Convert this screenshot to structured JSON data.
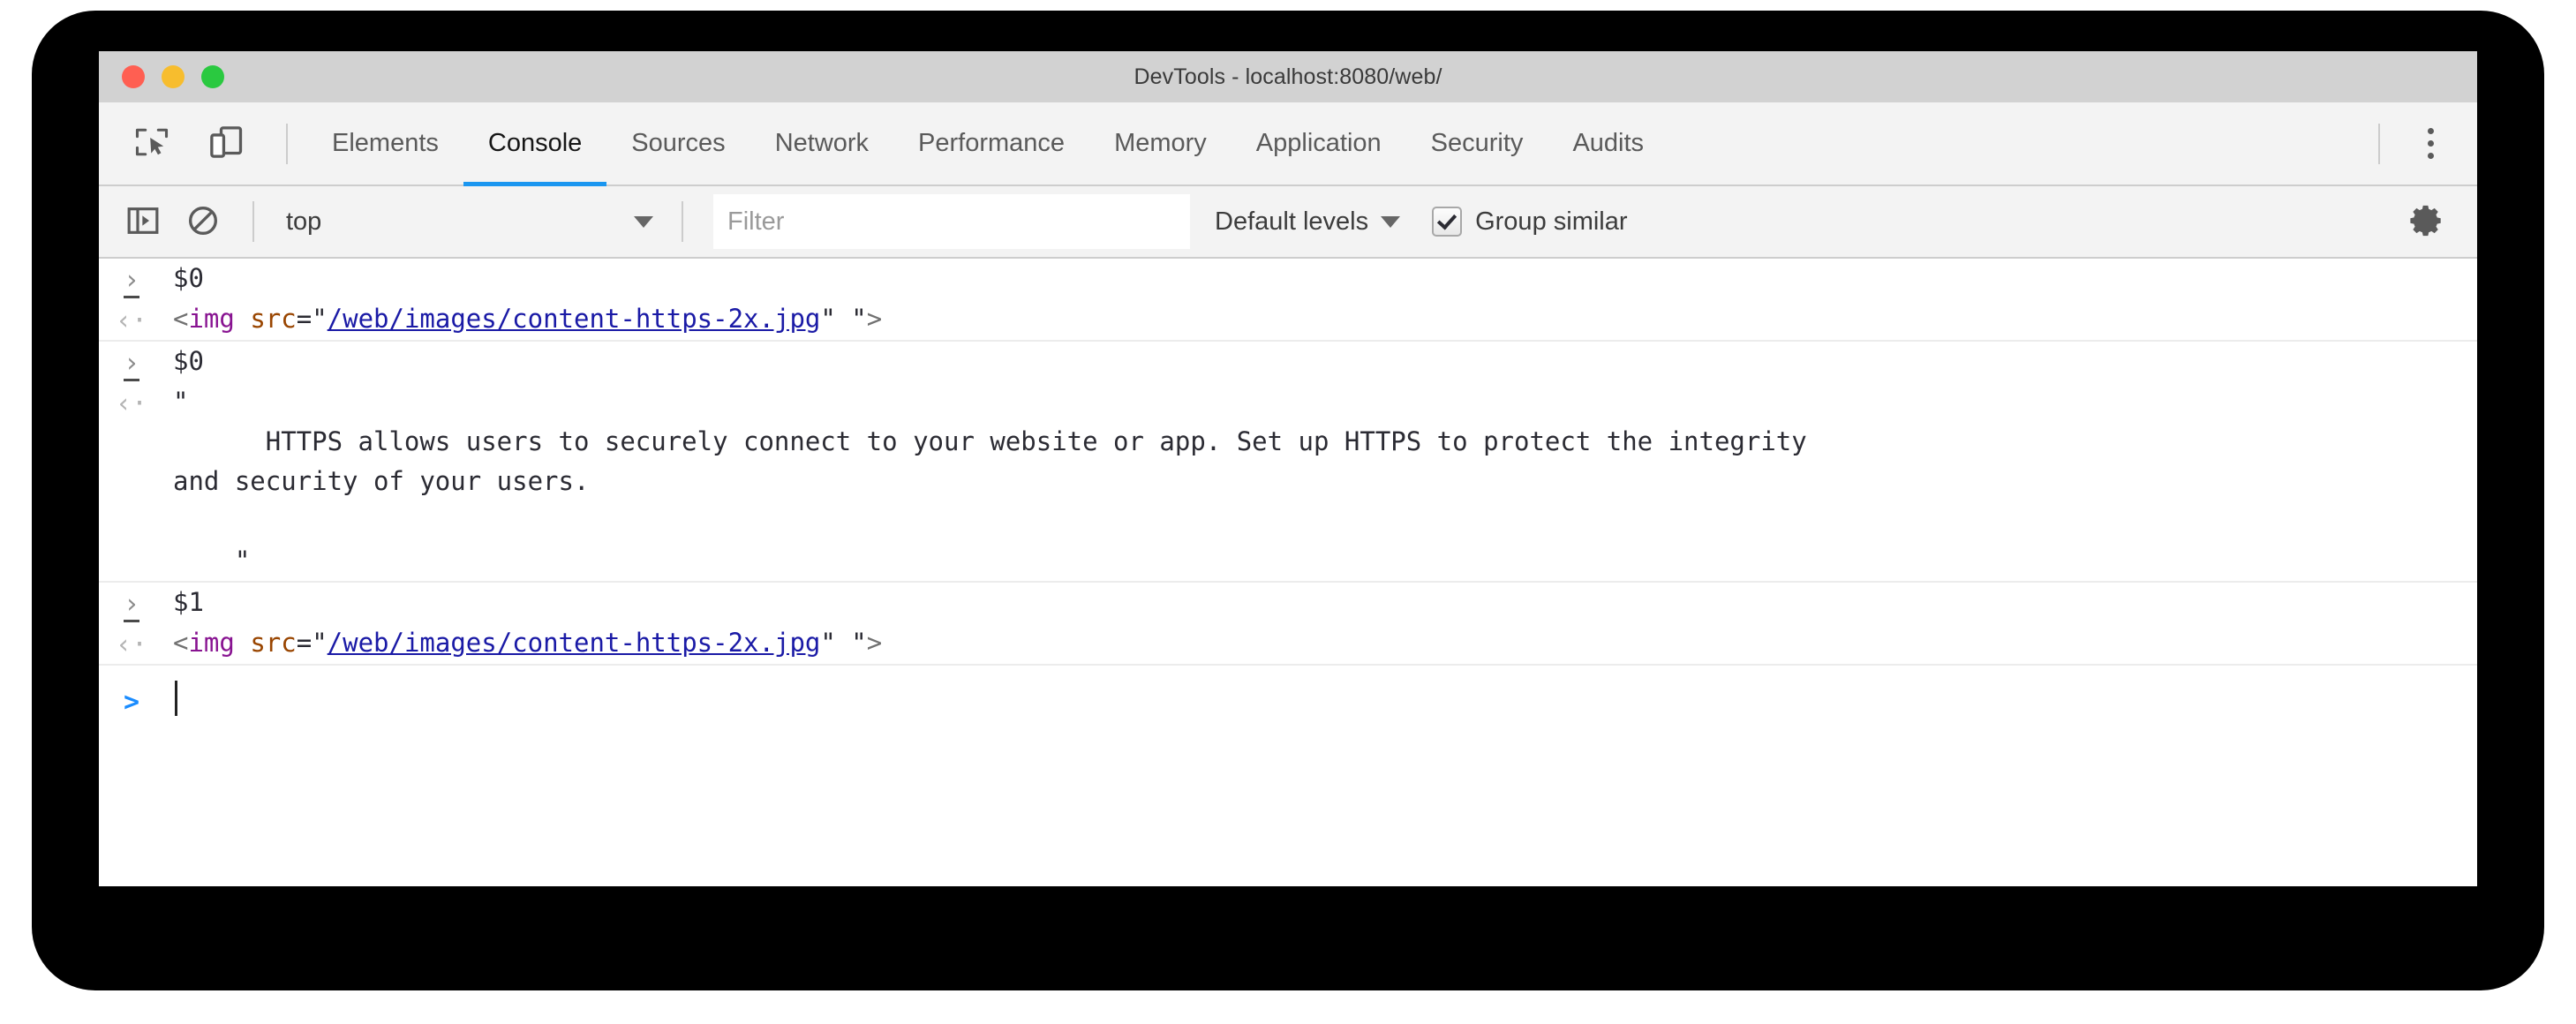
{
  "window": {
    "title": "DevTools - localhost:8080/web/",
    "traffic_lights": [
      {
        "name": "close",
        "color": "#ff5f52"
      },
      {
        "name": "minimize",
        "color": "#f7bd2e"
      },
      {
        "name": "maximize",
        "color": "#2ac940"
      }
    ]
  },
  "toolbar_icons": {
    "inspect": "inspect-element-icon",
    "device": "device-toolbar-icon"
  },
  "tabs": [
    {
      "label": "Elements",
      "active": false
    },
    {
      "label": "Console",
      "active": true
    },
    {
      "label": "Sources",
      "active": false
    },
    {
      "label": "Network",
      "active": false
    },
    {
      "label": "Performance",
      "active": false
    },
    {
      "label": "Memory",
      "active": false
    },
    {
      "label": "Application",
      "active": false
    },
    {
      "label": "Security",
      "active": false
    },
    {
      "label": "Audits",
      "active": false
    }
  ],
  "console_toolbar": {
    "sidebar_toggle": "show-console-sidebar-icon",
    "clear_console": "clear-console-icon",
    "context": "top",
    "filter_placeholder": "Filter",
    "filter_value": "",
    "levels": "Default levels",
    "group_similar_label": "Group similar",
    "group_similar_checked": true,
    "settings": "settings-gear-icon"
  },
  "colors": {
    "accent": "#1a96f0",
    "tag": "#881391",
    "attribute": "#994500",
    "url": "#1a1aa6",
    "prompt": "#1a8cff"
  },
  "console_groups": [
    {
      "input": "$0",
      "output_type": "html",
      "output_html": {
        "open": "<",
        "tag": "img",
        "space": " ",
        "attr": "src",
        "eq": "=",
        "quote_open": "\"",
        "url": "/web/images/content-https-2x.jpg",
        "quote_close": "\"",
        "trailing": " \"",
        "close": ">"
      }
    },
    {
      "input": "$0",
      "output_type": "string",
      "output_lines": [
        "\"",
        "      HTTPS allows users to securely connect to your website or app. Set up HTTPS to protect the integrity",
        "and security of your users.",
        "",
        "    \""
      ]
    },
    {
      "input": "$1",
      "output_type": "html",
      "output_html": {
        "open": "<",
        "tag": "img",
        "space": " ",
        "attr": "src",
        "eq": "=",
        "quote_open": "\"",
        "url": "/web/images/content-https-2x.jpg",
        "quote_close": "\"",
        "trailing": " \"",
        "close": ">"
      }
    }
  ],
  "prompt": {
    "glyph": ">",
    "value": ""
  }
}
